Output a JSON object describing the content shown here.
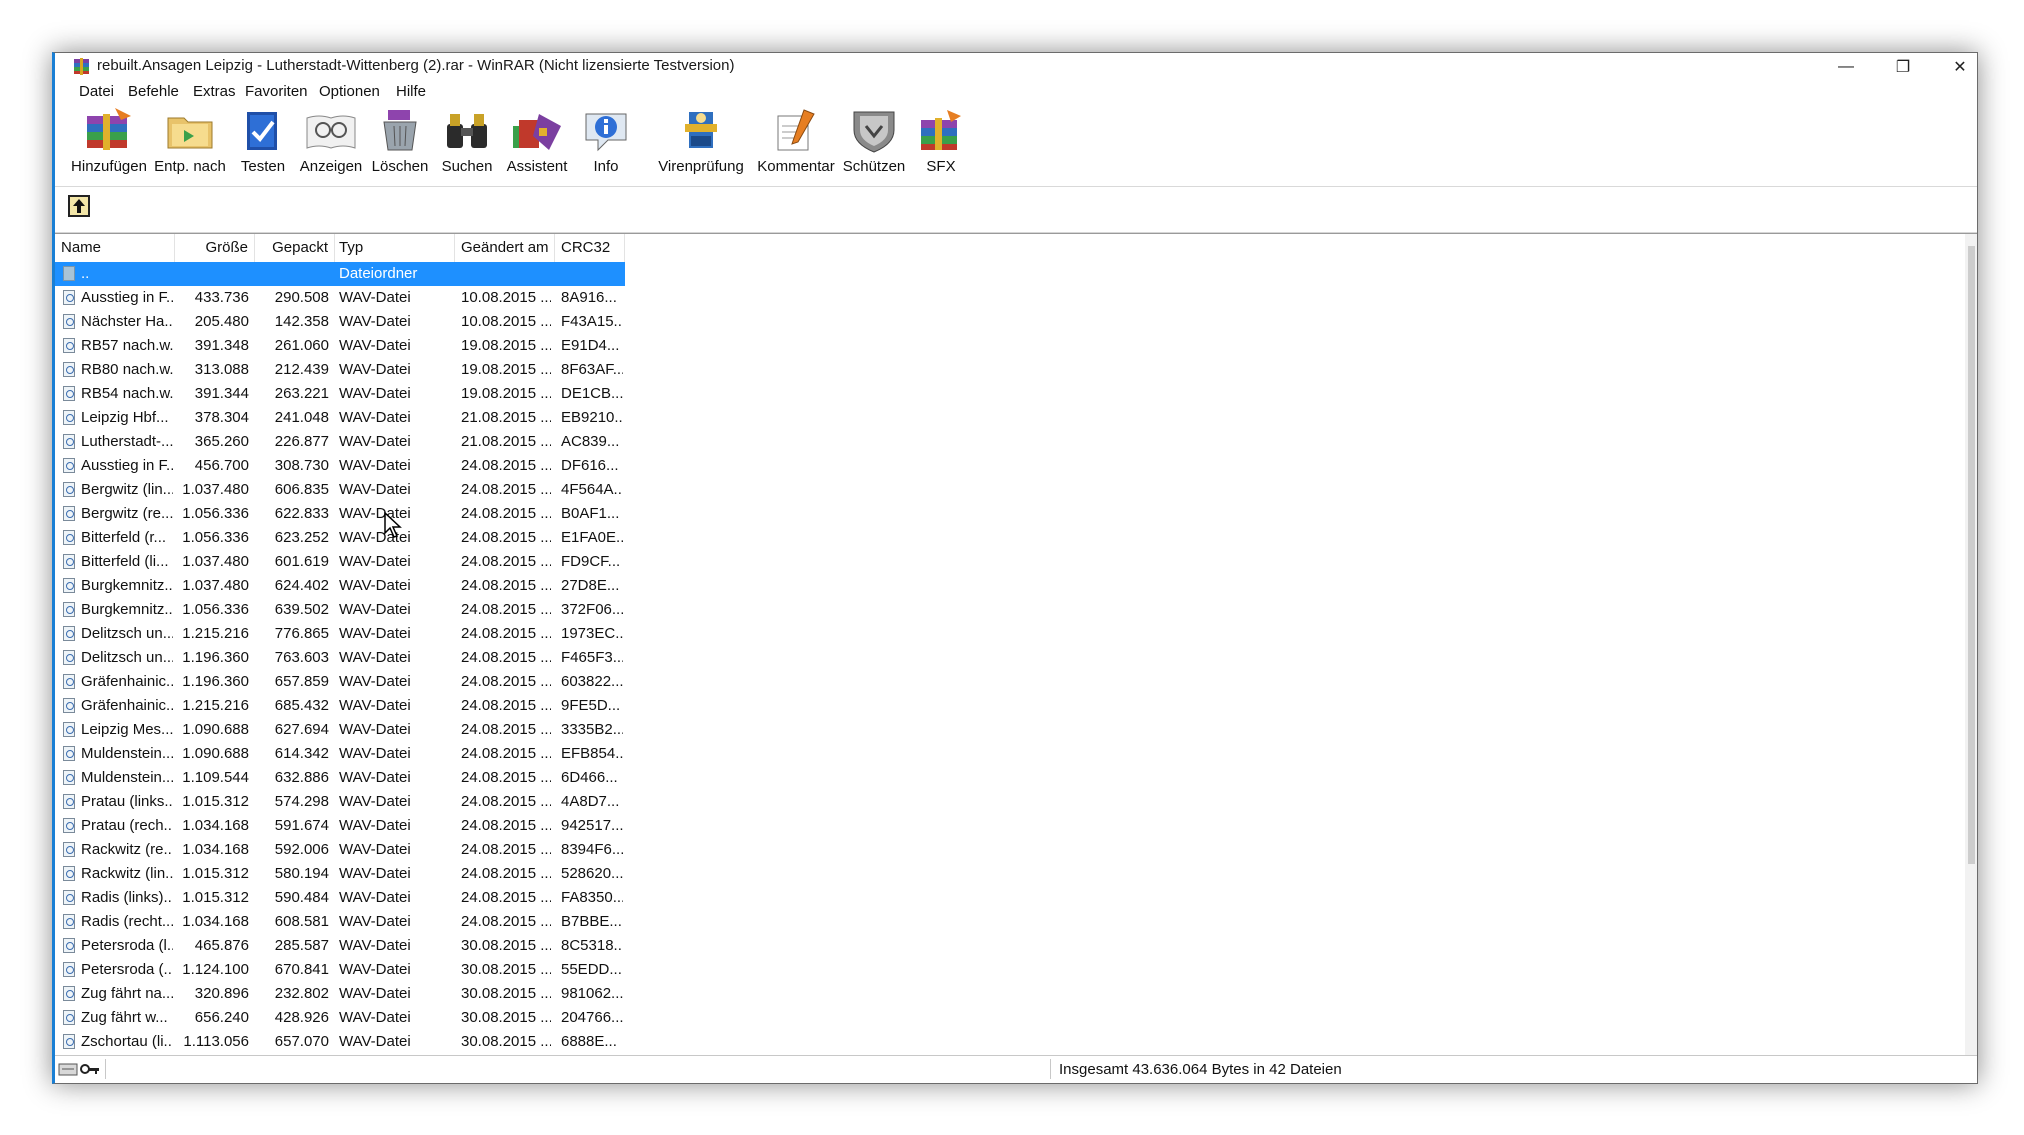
{
  "window": {
    "title": "rebuilt.Ansagen Leipzig - Lutherstadt-Wittenberg (2).rar - WinRAR (Nicht lizensierte Testversion)",
    "minimize_glyph": "—",
    "maximize_glyph": "❐",
    "close_glyph": "✕"
  },
  "menu": {
    "items": [
      {
        "label": "Datei"
      },
      {
        "label": "Befehle"
      },
      {
        "label": "Extras"
      },
      {
        "label": "Favoriten"
      },
      {
        "label": "Optionen"
      },
      {
        "label": "Hilfe"
      }
    ]
  },
  "toolbar": {
    "buttons": [
      {
        "label": "Hinzufügen",
        "icon": "add-archive-icon"
      },
      {
        "label": "Entp. nach",
        "icon": "extract-to-icon"
      },
      {
        "label": "Testen",
        "icon": "test-icon"
      },
      {
        "label": "Anzeigen",
        "icon": "view-icon"
      },
      {
        "label": "Löschen",
        "icon": "delete-icon"
      },
      {
        "label": "Suchen",
        "icon": "find-icon"
      },
      {
        "label": "Assistent",
        "icon": "wizard-icon"
      },
      {
        "label": "Info",
        "icon": "info-icon"
      },
      {
        "label": "Virenprüfung",
        "icon": "virus-scan-icon"
      },
      {
        "label": "Kommentar",
        "icon": "comment-icon"
      },
      {
        "label": "Schützen",
        "icon": "protect-icon"
      },
      {
        "label": "SFX",
        "icon": "sfx-icon"
      }
    ]
  },
  "columns": [
    {
      "key": "name",
      "label": "Name"
    },
    {
      "key": "size",
      "label": "Größe"
    },
    {
      "key": "packed",
      "label": "Gepackt"
    },
    {
      "key": "type",
      "label": "Typ"
    },
    {
      "key": "modified",
      "label": "Geändert am"
    },
    {
      "key": "crc",
      "label": "CRC32"
    }
  ],
  "parent_row": {
    "name": "..",
    "type": "Dateiordner"
  },
  "rows": [
    {
      "name": "Ausstieg in F...",
      "size": "433.736",
      "packed": "290.508",
      "type": "WAV-Datei",
      "modified": "10.08.2015 ...",
      "crc": "8A916..."
    },
    {
      "name": "Nächster Ha...",
      "size": "205.480",
      "packed": "142.358",
      "type": "WAV-Datei",
      "modified": "10.08.2015 ...",
      "crc": "F43A15..."
    },
    {
      "name": "RB57 nach.w...",
      "size": "391.348",
      "packed": "261.060",
      "type": "WAV-Datei",
      "modified": "19.08.2015 ...",
      "crc": "E91D4..."
    },
    {
      "name": "RB80 nach.w...",
      "size": "313.088",
      "packed": "212.439",
      "type": "WAV-Datei",
      "modified": "19.08.2015 ...",
      "crc": "8F63AF..."
    },
    {
      "name": "RB54 nach.w...",
      "size": "391.344",
      "packed": "263.221",
      "type": "WAV-Datei",
      "modified": "19.08.2015 ...",
      "crc": "DE1CB..."
    },
    {
      "name": "Leipzig Hbf...",
      "size": "378.304",
      "packed": "241.048",
      "type": "WAV-Datei",
      "modified": "21.08.2015 ...",
      "crc": "EB9210..."
    },
    {
      "name": "Lutherstadt-...",
      "size": "365.260",
      "packed": "226.877",
      "type": "WAV-Datei",
      "modified": "21.08.2015 ...",
      "crc": "AC839..."
    },
    {
      "name": "Ausstieg in F...",
      "size": "456.700",
      "packed": "308.730",
      "type": "WAV-Datei",
      "modified": "24.08.2015 ...",
      "crc": "DF616..."
    },
    {
      "name": "Bergwitz (lin...",
      "size": "1.037.480",
      "packed": "606.835",
      "type": "WAV-Datei",
      "modified": "24.08.2015 ...",
      "crc": "4F564A..."
    },
    {
      "name": "Bergwitz (re...",
      "size": "1.056.336",
      "packed": "622.833",
      "type": "WAV-Datei",
      "modified": "24.08.2015 ...",
      "crc": "B0AF1..."
    },
    {
      "name": "Bitterfeld (r...",
      "size": "1.056.336",
      "packed": "623.252",
      "type": "WAV-Datei",
      "modified": "24.08.2015 ...",
      "crc": "E1FA0E..."
    },
    {
      "name": "Bitterfeld (li...",
      "size": "1.037.480",
      "packed": "601.619",
      "type": "WAV-Datei",
      "modified": "24.08.2015 ...",
      "crc": "FD9CF..."
    },
    {
      "name": "Burgkemnitz...",
      "size": "1.037.480",
      "packed": "624.402",
      "type": "WAV-Datei",
      "modified": "24.08.2015 ...",
      "crc": "27D8E..."
    },
    {
      "name": "Burgkemnitz...",
      "size": "1.056.336",
      "packed": "639.502",
      "type": "WAV-Datei",
      "modified": "24.08.2015 ...",
      "crc": "372F06..."
    },
    {
      "name": "Delitzsch un...",
      "size": "1.215.216",
      "packed": "776.865",
      "type": "WAV-Datei",
      "modified": "24.08.2015 ...",
      "crc": "1973EC..."
    },
    {
      "name": "Delitzsch un...",
      "size": "1.196.360",
      "packed": "763.603",
      "type": "WAV-Datei",
      "modified": "24.08.2015 ...",
      "crc": "F465F3..."
    },
    {
      "name": "Gräfenhainic...",
      "size": "1.196.360",
      "packed": "657.859",
      "type": "WAV-Datei",
      "modified": "24.08.2015 ...",
      "crc": "603822..."
    },
    {
      "name": "Gräfenhainic...",
      "size": "1.215.216",
      "packed": "685.432",
      "type": "WAV-Datei",
      "modified": "24.08.2015 ...",
      "crc": "9FE5D..."
    },
    {
      "name": "Leipzig Mes...",
      "size": "1.090.688",
      "packed": "627.694",
      "type": "WAV-Datei",
      "modified": "24.08.2015 ...",
      "crc": "3335B2..."
    },
    {
      "name": "Muldenstein...",
      "size": "1.090.688",
      "packed": "614.342",
      "type": "WAV-Datei",
      "modified": "24.08.2015 ...",
      "crc": "EFB854..."
    },
    {
      "name": "Muldenstein...",
      "size": "1.109.544",
      "packed": "632.886",
      "type": "WAV-Datei",
      "modified": "24.08.2015 ...",
      "crc": "6D466..."
    },
    {
      "name": "Pratau (links...",
      "size": "1.015.312",
      "packed": "574.298",
      "type": "WAV-Datei",
      "modified": "24.08.2015 ...",
      "crc": "4A8D7..."
    },
    {
      "name": "Pratau (rech...",
      "size": "1.034.168",
      "packed": "591.674",
      "type": "WAV-Datei",
      "modified": "24.08.2015 ...",
      "crc": "942517..."
    },
    {
      "name": "Rackwitz (re...",
      "size": "1.034.168",
      "packed": "592.006",
      "type": "WAV-Datei",
      "modified": "24.08.2015 ...",
      "crc": "8394F6..."
    },
    {
      "name": "Rackwitz (lin...",
      "size": "1.015.312",
      "packed": "580.194",
      "type": "WAV-Datei",
      "modified": "24.08.2015 ...",
      "crc": "528620..."
    },
    {
      "name": "Radis (links)....",
      "size": "1.015.312",
      "packed": "590.484",
      "type": "WAV-Datei",
      "modified": "24.08.2015 ...",
      "crc": "FA8350..."
    },
    {
      "name": "Radis (recht...",
      "size": "1.034.168",
      "packed": "608.581",
      "type": "WAV-Datei",
      "modified": "24.08.2015 ...",
      "crc": "B7BBE..."
    },
    {
      "name": "Petersroda (l...",
      "size": "465.876",
      "packed": "285.587",
      "type": "WAV-Datei",
      "modified": "30.08.2015 ...",
      "crc": "8C5318..."
    },
    {
      "name": "Petersroda (...",
      "size": "1.124.100",
      "packed": "670.841",
      "type": "WAV-Datei",
      "modified": "30.08.2015 ...",
      "crc": "55EDD..."
    },
    {
      "name": "Zug fährt na...",
      "size": "320.896",
      "packed": "232.802",
      "type": "WAV-Datei",
      "modified": "30.08.2015 ...",
      "crc": "981062..."
    },
    {
      "name": "Zug fährt w...",
      "size": "656.240",
      "packed": "428.926",
      "type": "WAV-Datei",
      "modified": "30.08.2015 ...",
      "crc": "204766..."
    },
    {
      "name": "Zschortau (li...",
      "size": "1.113.056",
      "packed": "657.070",
      "type": "WAV-Datei",
      "modified": "30.08.2015 ...",
      "crc": "6888E..."
    }
  ],
  "status": {
    "summary": "Insgesamt 43.636.064 Bytes in 42 Dateien"
  },
  "colors": {
    "selection": "#1e90ff",
    "accent_border": "#1a7fd4"
  }
}
